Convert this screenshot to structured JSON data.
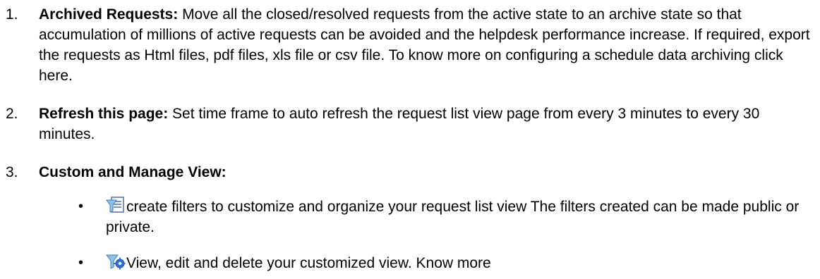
{
  "items": [
    {
      "number": "1.",
      "title": "Archived Requests:",
      "text": " Move all the closed/resolved requests from the active state to an archive state so that accumulation of millions of active requests can be avoided and the helpdesk performance increase. If required, export the requests as Html files, pdf files, xls file or csv file. To know more on configuring a schedule data archiving click here."
    },
    {
      "number": "2.",
      "title": "Refresh this page:",
      "text": " Set time frame to auto refresh the request list view page from every 3 minutes to every 30 minutes."
    },
    {
      "number": "3.",
      "title": "Custom and Manage View:",
      "text": ""
    }
  ],
  "bullets": [
    {
      "symbol": "•",
      "icon": "filter-document-icon",
      "text": "create filters to customize and organize your request list view  The filters created can be made public or private."
    },
    {
      "symbol": "•",
      "icon": "filter-gear-icon",
      "text": "View, edit and delete your customized view. Know more"
    }
  ]
}
